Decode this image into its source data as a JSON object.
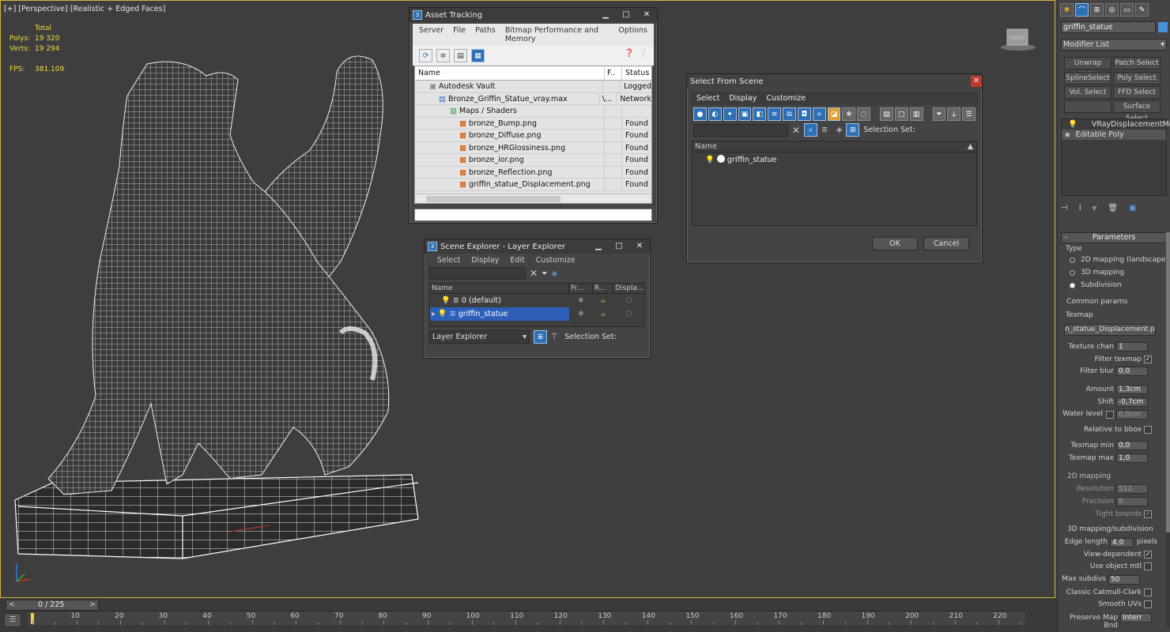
{
  "viewport": {
    "label": "[+] [Perspective] [Realistic + Edged Faces]",
    "stats": {
      "total_label": "Total",
      "polys_label": "Polys:",
      "polys_value": "19 320",
      "verts_label": "Verts:",
      "verts_value": "19 294",
      "fps_label": "FPS:",
      "fps_value": "381.109"
    },
    "viewcube_label": "FRONT"
  },
  "asset_tracking": {
    "title": "Asset Tracking",
    "menu": [
      "Server",
      "File",
      "Paths",
      "Bitmap Performance and Memory",
      "Options"
    ],
    "columns": {
      "name": "Name",
      "f": "F..",
      "status": "Status"
    },
    "rows": [
      {
        "name": "Autodesk Vault",
        "f": "",
        "status": "Logged"
      },
      {
        "name": "Bronze_Griffin_Statue_vray.max",
        "f": "\\...",
        "status": "Network"
      },
      {
        "name": "Maps / Shaders",
        "f": "",
        "status": ""
      },
      {
        "name": "bronze_Bump.png",
        "f": "",
        "status": "Found"
      },
      {
        "name": "bronze_Diffuse.png",
        "f": "",
        "status": "Found"
      },
      {
        "name": "bronze_HRGlossiness.png",
        "f": "",
        "status": "Found"
      },
      {
        "name": "bronze_ior.png",
        "f": "",
        "status": "Found"
      },
      {
        "name": "bronze_Reflection.png",
        "f": "",
        "status": "Found"
      },
      {
        "name": "griffin_statue_Displacement.png",
        "f": "",
        "status": "Found"
      }
    ]
  },
  "select_from_scene": {
    "title": "Select From Scene",
    "menu": [
      "Select",
      "Display",
      "Customize"
    ],
    "selection_set_label": "Selection Set:",
    "column_name": "Name",
    "items": [
      "griffin_statue"
    ],
    "ok_label": "OK",
    "cancel_label": "Cancel"
  },
  "scene_explorer": {
    "title": "Scene Explorer - Layer Explorer",
    "menu": [
      "Select",
      "Display",
      "Edit",
      "Customize"
    ],
    "columns": {
      "name": "Name",
      "fr": "Fr...",
      "r": "R...",
      "disp": "Displa..."
    },
    "rows": [
      {
        "name": "0 (default)"
      },
      {
        "name": "griffin_statue"
      }
    ],
    "explorer_dropdown": "Layer Explorer",
    "selection_set_label": "Selection Set:"
  },
  "command_panel": {
    "object_name": "griffin_statue",
    "modifier_list": "Modifier List",
    "mod_buttons": [
      "Unwrap UVW",
      "Patch Select",
      "SplineSelect",
      "Poly Select",
      "Vol. Select",
      "FFD Select",
      "",
      "Surface Select"
    ],
    "stack": [
      "VRayDisplacementMod",
      "Editable Poly"
    ],
    "rollout_title": "Parameters",
    "type_label": "Type",
    "type_options": [
      "2D mapping (landscape)",
      "3D mapping",
      "Subdivision"
    ],
    "type_selected": 2,
    "common_params_label": "Common params",
    "texmap_label": "Texmap",
    "texmap_value": "n_statue_Displacement.png)",
    "texture_chan_label": "Texture chan",
    "texture_chan_value": "1",
    "filter_texmap_label": "Filter texmap",
    "filter_blur_label": "Filter blur",
    "filter_blur_value": "0,0",
    "amount_label": "Amount",
    "amount_value": "1,3cm",
    "shift_label": "Shift",
    "shift_value": "-0,7cm",
    "water_level_label": "Water level",
    "water_level_value": "0,0cm",
    "relative_bbox_label": "Relative to bbox",
    "texmap_min_label": "Texmap min",
    "texmap_min_value": "0,0",
    "texmap_max_label": "Texmap max",
    "texmap_max_value": "1,0",
    "mapping2d_label": "2D mapping",
    "resolution_label": "Resolution",
    "resolution_value": "512",
    "precision_label": "Precision",
    "precision_value": "8",
    "tight_bounds_label": "Tight bounds",
    "mapping3d_label": "3D mapping/subdivision",
    "edge_length_label": "Edge length",
    "edge_length_value": "4,0",
    "pixels_label": "pixels",
    "view_dependent_label": "View-dependent",
    "use_object_mtl_label": "Use object mtl",
    "max_subdivs_label": "Max subdivs",
    "max_subdivs_value": "50",
    "classic_catmull_label": "Classic Catmull-Clark",
    "smooth_uvs_label": "Smooth UVs",
    "preserve_map_label": "Preserve Map Bnd",
    "preserve_map_value": "Interr"
  },
  "timeline": {
    "frame_display": "0 / 225",
    "ticks": [
      "0",
      "10",
      "20",
      "30",
      "40",
      "50",
      "60",
      "70",
      "80",
      "90",
      "100",
      "110",
      "120",
      "130",
      "140",
      "150",
      "160",
      "170",
      "180",
      "190",
      "200",
      "210",
      "220"
    ]
  }
}
